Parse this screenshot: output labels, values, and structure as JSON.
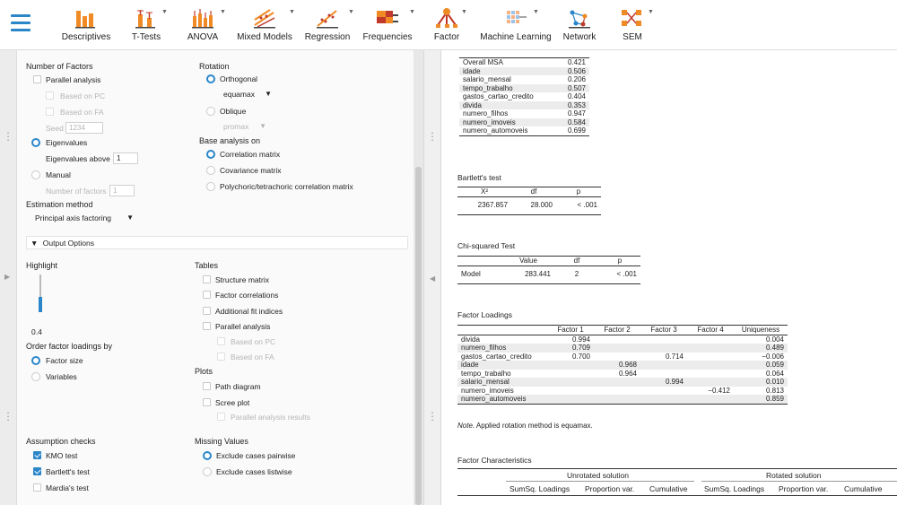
{
  "toolbar": {
    "items": [
      {
        "label": "Descriptives",
        "icon": "descriptives-icon",
        "caret": false
      },
      {
        "label": "T-Tests",
        "icon": "t-tests-icon",
        "caret": true
      },
      {
        "label": "ANOVA",
        "icon": "anova-icon",
        "caret": true
      },
      {
        "label": "Mixed Models",
        "icon": "mixed-models-icon",
        "caret": true
      },
      {
        "label": "Regression",
        "icon": "regression-icon",
        "caret": true
      },
      {
        "label": "Frequencies",
        "icon": "frequencies-icon",
        "caret": true
      },
      {
        "label": "Factor",
        "icon": "factor-icon",
        "caret": true
      },
      {
        "label": "Machine Learning",
        "icon": "machine-learning-icon",
        "caret": true
      },
      {
        "label": "Network",
        "icon": "network-icon",
        "caret": false
      },
      {
        "label": "SEM",
        "icon": "sem-icon",
        "caret": true
      }
    ],
    "colors": {
      "accent": "#2a86c9",
      "orange": "#f08a24",
      "red": "#c0392b"
    }
  },
  "options": {
    "number_of_factors": "Number of Factors",
    "parallel_analysis": "Parallel analysis",
    "based_on_pc": "Based on PC",
    "based_on_fa": "Based on FA",
    "seed_label": "Seed",
    "seed_value": "1234",
    "eigenvalues": "Eigenvalues",
    "eigenvalues_above": "Eigenvalues above",
    "eigenvalues_above_value": "1",
    "manual": "Manual",
    "number_of_factors_field": "Number of factors",
    "number_of_factors_value": "1",
    "estimation_method": "Estimation method",
    "estimation_value": "Principal axis factoring",
    "rotation": "Rotation",
    "orthogonal": "Orthogonal",
    "orthogonal_value": "equamax",
    "oblique": "Oblique",
    "oblique_value": "promax",
    "base_analysis_on": "Base analysis on",
    "correlation_matrix": "Correlation matrix",
    "covariance_matrix": "Covariance matrix",
    "polychoric": "Polychoric/tetrachoric correlation matrix",
    "output_options": "Output Options",
    "highlight": "Highlight",
    "highlight_value": "0.4",
    "highlight_fraction": 0.4,
    "order_loadings": "Order factor loadings by",
    "factor_size": "Factor size",
    "variables": "Variables",
    "tables": "Tables",
    "structure_matrix": "Structure matrix",
    "factor_correlations": "Factor correlations",
    "additional_fit": "Additional fit indices",
    "parallel_analysis_tbl": "Parallel analysis",
    "based_on_pc_tbl": "Based on PC",
    "based_on_fa_tbl": "Based on FA",
    "plots": "Plots",
    "path_diagram": "Path diagram",
    "scree_plot": "Scree plot",
    "parallel_results": "Parallel analysis results",
    "assumption_checks": "Assumption checks",
    "kmo_test": "KMO test",
    "bartletts_test": "Bartlett's test",
    "mardias_test": "Mardia's test",
    "missing_values": "Missing Values",
    "exclude_pairwise": "Exclude cases pairwise",
    "exclude_listwise": "Exclude cases listwise"
  },
  "results": {
    "kmo_rows": [
      {
        "name": "Overall MSA",
        "value": "0.421"
      },
      {
        "name": "idade",
        "value": "0.506"
      },
      {
        "name": "salario_mensal",
        "value": "0.206"
      },
      {
        "name": "tempo_trabalho",
        "value": "0.507"
      },
      {
        "name": "gastos_cartao_credito",
        "value": "0.404"
      },
      {
        "name": "divida",
        "value": "0.353"
      },
      {
        "name": "numero_filhos",
        "value": "0.947"
      },
      {
        "name": "numero_imoveis",
        "value": "0.584"
      },
      {
        "name": "numero_automoveis",
        "value": "0.699"
      }
    ],
    "bartlett": {
      "title": "Bartlett's test",
      "headers": [
        "X²",
        "df",
        "p"
      ],
      "row": [
        "2367.857",
        "28.000",
        "< .001"
      ]
    },
    "chisq": {
      "title": "Chi-squared Test",
      "headers": [
        "",
        "Value",
        "df",
        "p"
      ],
      "row": [
        "Model",
        "283.441",
        "2",
        "< .001"
      ]
    },
    "loadings": {
      "title": "Factor Loadings",
      "headers": [
        "",
        "Factor 1",
        "Factor 2",
        "Factor 3",
        "Factor 4",
        "Uniqueness"
      ],
      "rows": [
        [
          "divida",
          "0.994",
          "",
          "",
          "",
          "0.004"
        ],
        [
          "numero_filhos",
          "0.709",
          "",
          "",
          "",
          "0.489"
        ],
        [
          "gastos_cartao_credito",
          "0.700",
          "",
          "0.714",
          "",
          "−0.006"
        ],
        [
          "idade",
          "",
          "0.968",
          "",
          "",
          "0.059"
        ],
        [
          "tempo_trabalho",
          "",
          "0.964",
          "",
          "",
          "0.064"
        ],
        [
          "salario_mensal",
          "",
          "",
          "0.994",
          "",
          "0.010"
        ],
        [
          "numero_imoveis",
          "",
          "",
          "",
          "−0.412",
          "0.813"
        ],
        [
          "numero_automoveis",
          "",
          "",
          "",
          "",
          "0.859"
        ]
      ],
      "note_label": "Note.",
      "note": "Applied rotation method is equamax."
    },
    "characteristics": {
      "title": "Factor Characteristics",
      "group1": "Unrotated solution",
      "group2": "Rotated solution",
      "headers": [
        "",
        "SumSq. Loadings",
        "Proportion var.",
        "Cumulative",
        "SumSq. Loadings",
        "Proportion var.",
        "Cumulative"
      ]
    }
  }
}
